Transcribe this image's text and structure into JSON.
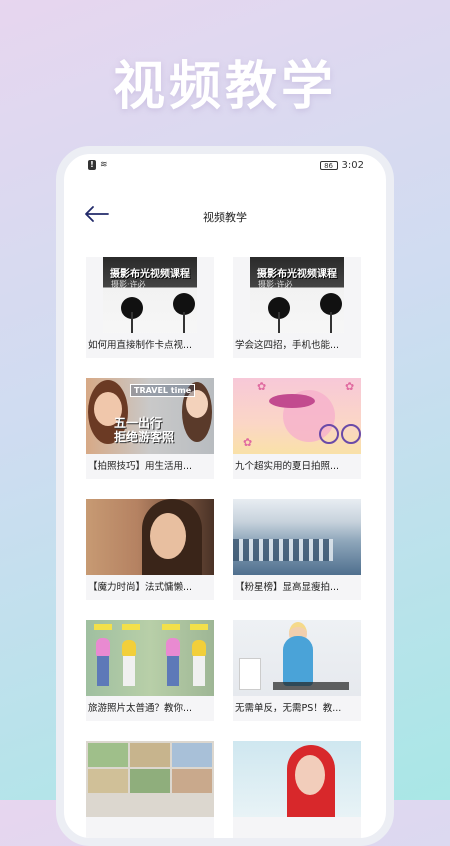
{
  "banner": {
    "title": "视频教学"
  },
  "status": {
    "time": "3:02",
    "battery": "86"
  },
  "nav": {
    "title": "视频教学"
  },
  "studio_text": {
    "title": "摄影布光视频课程",
    "subtitle": "摄影·许必"
  },
  "travel_text": {
    "label": "TRAVEL time",
    "line1": "五一出行",
    "line2": "拒绝游客照"
  },
  "videos": [
    {
      "caption": "如何用直接制作卡点视...",
      "thumb": "studio"
    },
    {
      "caption": "学会这四招，手机也能...",
      "thumb": "studio"
    },
    {
      "caption": "【拍照技巧】用生活用...",
      "thumb": "travel"
    },
    {
      "caption": "九个超实用的夏日拍照...",
      "thumb": "summer"
    },
    {
      "caption": "【魔力时尚】法式慵懒...",
      "thumb": "portrait"
    },
    {
      "caption": "【粉星榜】显高显瘦拍...",
      "thumb": "pier"
    },
    {
      "caption": "旅游照片太普通？教你...",
      "thumb": "fashion"
    },
    {
      "caption": "无需单反，无需PS！教...",
      "thumb": "home"
    },
    {
      "caption": "",
      "thumb": "collage"
    },
    {
      "caption": "",
      "thumb": "redhair"
    }
  ]
}
